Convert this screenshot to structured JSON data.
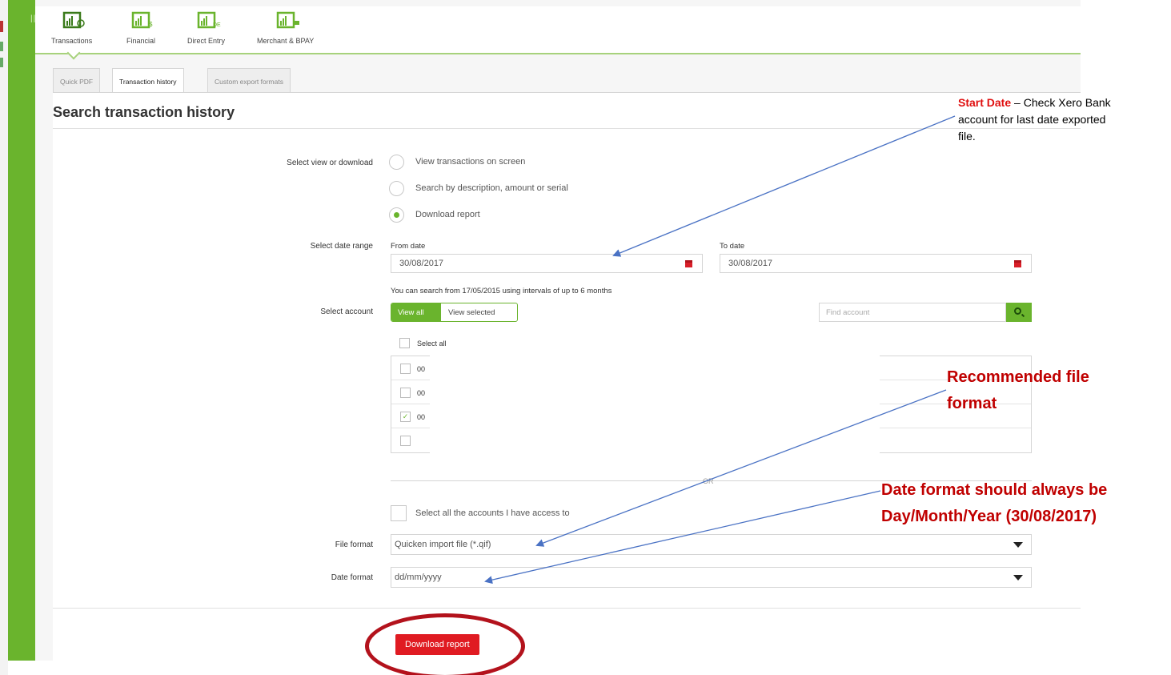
{
  "nav": {
    "items": [
      {
        "label": "Transactions",
        "icon": "transactions-chart-icon"
      },
      {
        "label": "Financial",
        "icon": "financial-chart-icon"
      },
      {
        "label": "Direct Entry",
        "icon": "direct-entry-chart-icon"
      },
      {
        "label": "Merchant & BPAY",
        "icon": "merchant-chart-icon"
      }
    ]
  },
  "tabs": [
    "Quick PDF",
    "Transaction history",
    "Custom export formats"
  ],
  "page": {
    "title": "Search transaction history"
  },
  "form": {
    "view_label": "Select view or download",
    "view_options": [
      "View transactions on screen",
      "Search by description, amount or serial",
      "Download report"
    ],
    "date_range_label": "Select date range",
    "from_label": "From date",
    "from_value": "30/08/2017",
    "to_label": "To date",
    "to_value": "30/08/2017",
    "range_hint": "You can search from 17/05/2015 using intervals of up to 6 months",
    "account_label": "Select account",
    "view_all": "View all",
    "view_selected": "View selected",
    "find_placeholder": "Find account",
    "select_all": "Select all",
    "accounts": [
      "00",
      "00",
      "00",
      ""
    ],
    "or_text": "OR",
    "all_access": "Select all the accounts I have access to",
    "file_format_label": "File format",
    "file_format_value": "Quicken import file (*.qif)",
    "date_format_label": "Date format",
    "date_format_value": "dd/mm/yyyy",
    "download_button": "Download report"
  },
  "annotations": {
    "start_date_title": "Start Date",
    "start_date_text": " – Check Xero Bank account for last date exported file.",
    "file_format_note": "Recommended file format",
    "date_format_note_1": "Date format should always be",
    "date_format_note_2": "Day/Month/Year (30/08/2017)"
  },
  "colors": {
    "brand_green": "#6ab42d",
    "action_red": "#e01b22",
    "annotation_red": "#c00000",
    "arrow_blue": "#4a72c4"
  }
}
